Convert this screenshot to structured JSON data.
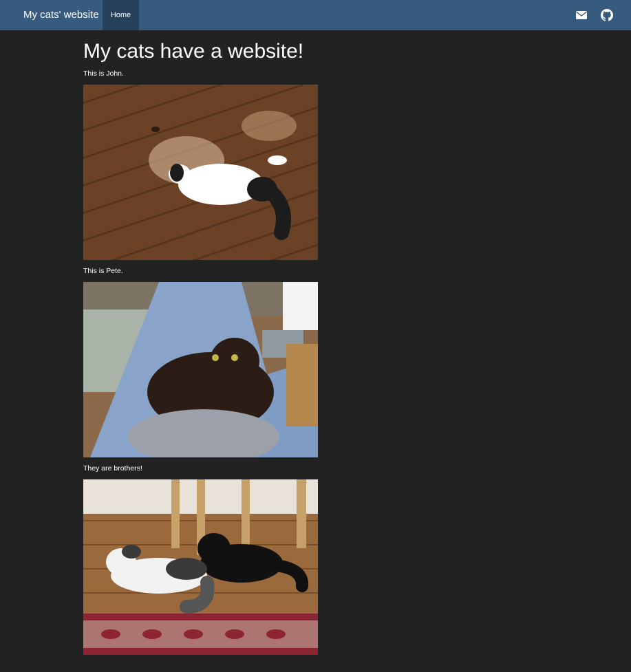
{
  "navbar": {
    "brand": "My cats' website",
    "links": [
      {
        "label": "Home",
        "active": true
      }
    ],
    "icons": [
      "envelope-icon",
      "github-icon"
    ],
    "bg_color": "#375a7f",
    "active_color": "#28415b"
  },
  "page": {
    "title": "My cats have a website!",
    "sections": [
      {
        "caption": "This is John.",
        "image": "photo of a black-and-white cat lying on a wooden floor"
      },
      {
        "caption": "This is Pete.",
        "image": "photo of a black fluffy cat sitting on a person's lap"
      },
      {
        "caption": "They are brothers!",
        "image": "photo of both cats lying together on a wooden floor near a rug"
      }
    ],
    "bg_color": "#222222"
  }
}
